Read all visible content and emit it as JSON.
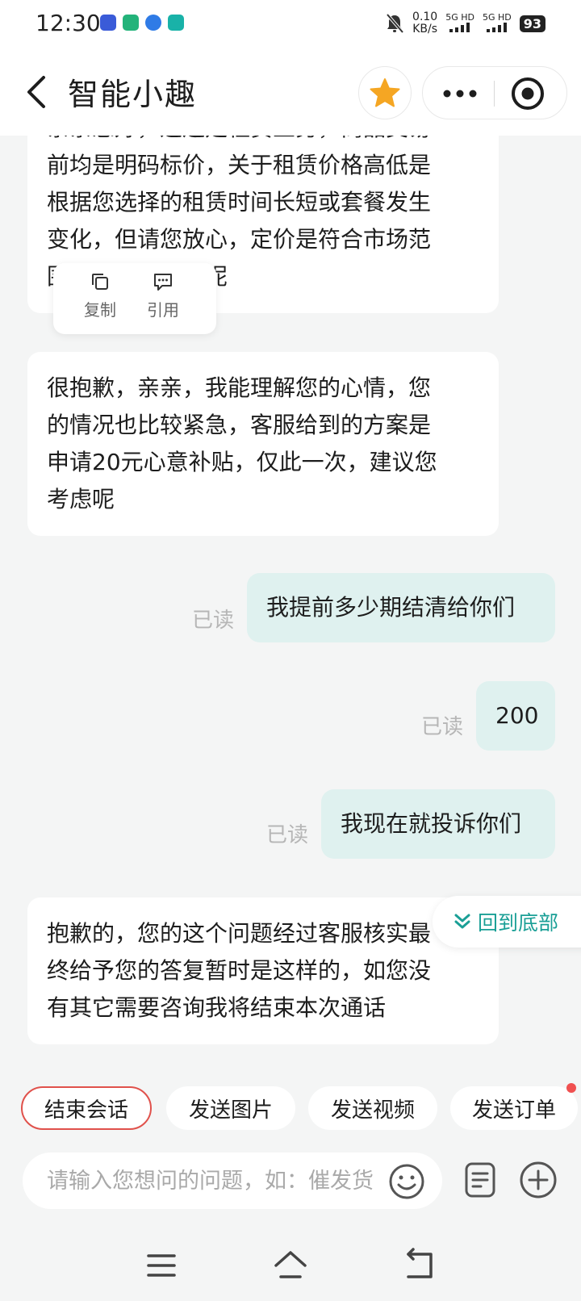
{
  "status_bar": {
    "time": "12:30",
    "net_speed_value": "0.10",
    "net_speed_unit": "KB/s",
    "signal_1": "5G HD",
    "signal_2": "5G HD",
    "battery": "93",
    "icons": [
      "app-icon-tiezhi",
      "app-icon-music",
      "app-icon-browser",
      "app-icon-boss",
      "mute-bell-icon",
      "signal-bars-icon",
      "battery-icon"
    ]
  },
  "header": {
    "title": "智能小趣",
    "icons": [
      "chevron-left-icon",
      "star-icon",
      "more-dots-icon",
      "target-close-icon"
    ]
  },
  "chat": {
    "messages": [
      {
        "side": "left",
        "lines": [
          "亲亲您好，这边是租赁业务，商品交易",
          "前均是明码标价，关于租赁价格高低是",
          "根据您选择的租赁时间长短或套餐发生",
          "变化，但请您放心，定价是符合市场范",
          "围的合理价格的呢"
        ]
      },
      {
        "side": "left",
        "lines": [
          "很抱歉，亲亲，我能理解您的心情，您",
          "的情况也比较紧急，客服给到的方案是",
          "申请20元心意补贴，仅此一次，建议您",
          "考虑呢"
        ]
      },
      {
        "side": "right",
        "text": "我提前多少期结清给你们",
        "status": "已读"
      },
      {
        "side": "right",
        "text": "200",
        "status": "已读"
      },
      {
        "side": "right",
        "text": "我现在就投诉你们",
        "status": "已读"
      },
      {
        "side": "left",
        "lines": [
          "抱歉的，您的这个问题经过客服核实最",
          "终给予您的答复暂时是这样的，如您没",
          "有其它需要咨询我将结束本次通话"
        ]
      }
    ]
  },
  "context_menu": {
    "copy_label": "复制",
    "quote_label": "引用"
  },
  "back_to_bottom": {
    "label": "回到底部"
  },
  "quick_actions": [
    {
      "label": "结束会话",
      "style": "outlined"
    },
    {
      "label": "发送图片"
    },
    {
      "label": "发送视频"
    },
    {
      "label": "发送订单",
      "badge": true
    }
  ],
  "input": {
    "value": "",
    "placeholder": "请输入您想问的问题，如：催发货"
  },
  "toolbar_icons": [
    "emoji-icon",
    "document-icon",
    "plus-circle-icon"
  ],
  "nav_bar_icons": [
    "menu-icon",
    "home-icon",
    "back-icon"
  ],
  "colors": {
    "accent": "#1a9f96",
    "user_bubble": "#dff1ef",
    "star": "#f5a623",
    "end_session_border": "#e0514b",
    "background": "#f4f5f5"
  }
}
